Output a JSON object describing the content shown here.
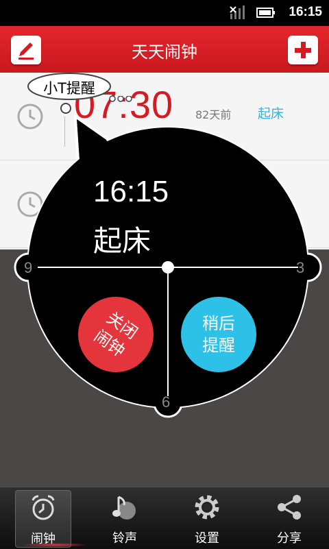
{
  "status_bar": {
    "time": "16:15"
  },
  "header": {
    "title": "天天闹钟",
    "edit_icon": "pencil-icon",
    "add_icon": "plus-icon"
  },
  "alarm_list": [
    {
      "time": "07:30",
      "ago": "82天前",
      "label": "起床"
    },
    {
      "time": "",
      "ago": "",
      "label": ""
    }
  ],
  "bubble": {
    "text": "小T提醒"
  },
  "popup": {
    "time": "16:15",
    "label": "起床",
    "dial": {
      "nine": "9",
      "three": "3",
      "six": "6"
    },
    "close_button": "关闭\n闹钟",
    "snooze_button": "稍后\n提醒"
  },
  "tabs": [
    {
      "label": "闹钟",
      "icon": "alarm-clock-icon",
      "active": true
    },
    {
      "label": "铃声",
      "icon": "music-note-icon",
      "active": false
    },
    {
      "label": "设置",
      "icon": "gear-icon",
      "active": false
    },
    {
      "label": "分享",
      "icon": "share-icon",
      "active": false
    }
  ],
  "colors": {
    "accent_red": "#d51b22",
    "blue": "#2fb6e2",
    "close_red": "#e3353b",
    "snooze_blue": "#2ec1e7"
  }
}
